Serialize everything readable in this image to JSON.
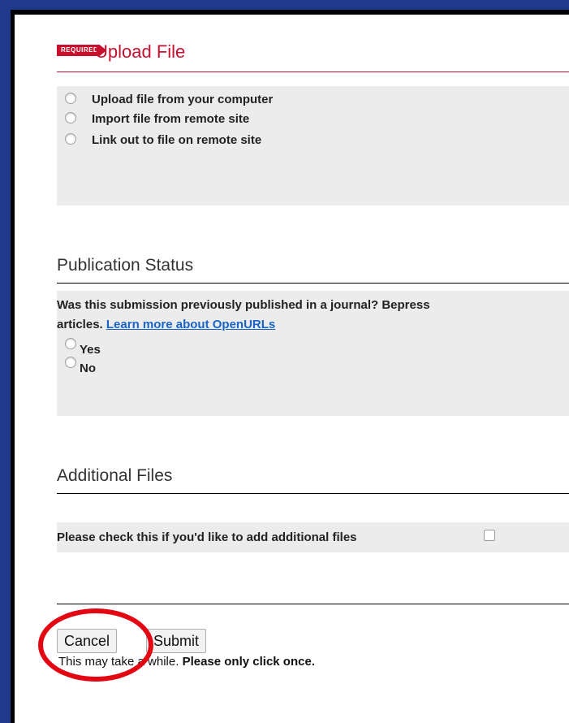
{
  "upload": {
    "badge": "REQUIRED",
    "title": "Upload File",
    "options": [
      {
        "label": "Upload file from your computer"
      },
      {
        "label": "Import file from remote site"
      },
      {
        "label": "Link out to file on remote site"
      }
    ]
  },
  "publication": {
    "heading": "Publication Status",
    "question_line1": "Was this submission previously published in a journal? Bepress",
    "question_line2": "articles.",
    "link": "Learn more about OpenURLs",
    "options": [
      {
        "label": "Yes"
      },
      {
        "label": "No"
      }
    ]
  },
  "additional": {
    "heading": "Additional Files",
    "checkbox_label": "Please check this if you'd like to add additional files"
  },
  "actions": {
    "cancel_label": "Cancel",
    "submit_label": "Submit",
    "note_plain": "This may take a while.",
    "note_bold": "Please only click once."
  },
  "colors": {
    "required_red": "#c8102e",
    "link_blue": "#1a63c5",
    "annotation_red": "#e30613",
    "outer_blue": "#1f3a8c"
  }
}
